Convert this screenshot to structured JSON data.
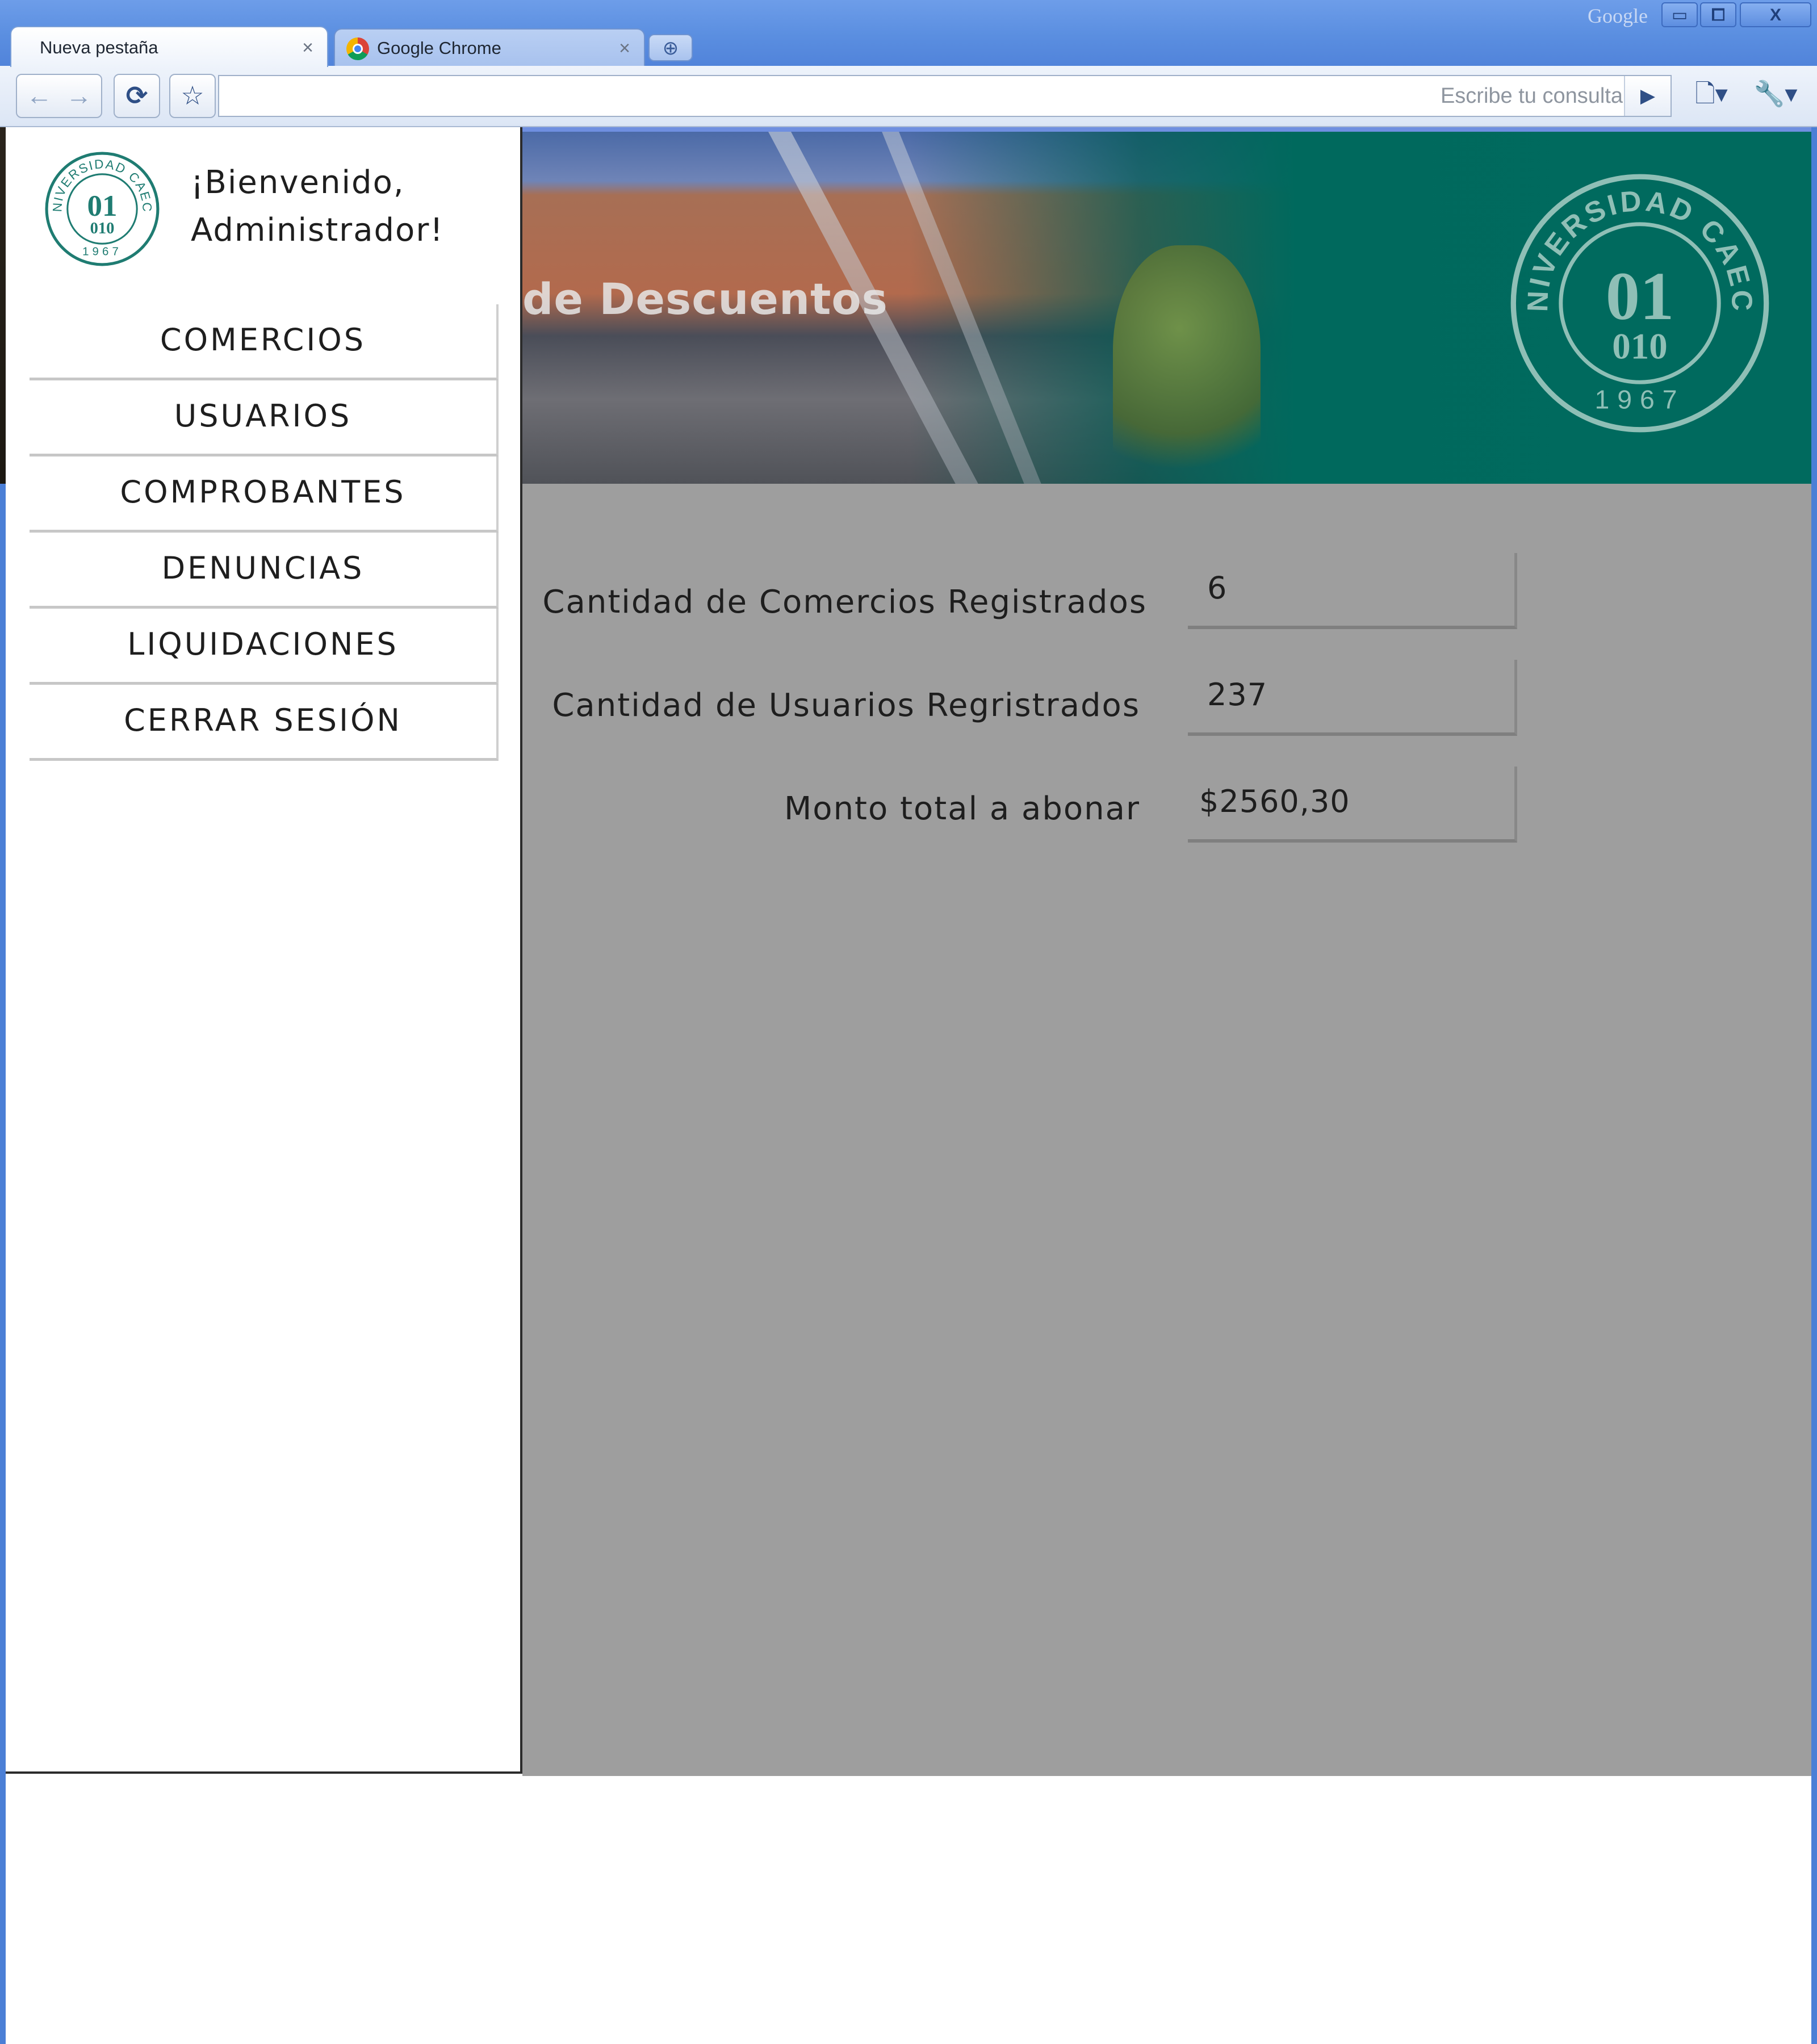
{
  "browser": {
    "google_label": "Google",
    "tabs": [
      {
        "label": "Nueva pestaña",
        "close": "×",
        "active": true
      },
      {
        "label": "Google Chrome",
        "close": "×",
        "active": false
      }
    ],
    "new_tab": "⊕",
    "window_buttons": {
      "minimize": "▭",
      "maximize": "⧠",
      "close": "X"
    },
    "toolbar": {
      "back": "←",
      "forward": "→",
      "reload": "⟳",
      "star": "☆",
      "omnibox_placeholder": "Escribe tu consulta",
      "go": "▶",
      "page_menu": "🗋▾",
      "wrench_menu": "🔧▾"
    }
  },
  "header": {
    "banner_title": "de Descuentos",
    "seal_text": "UNIVERSIDAD CAECE",
    "seal_top": "01",
    "seal_bottom": "010",
    "seal_year": "1967"
  },
  "sidebar": {
    "welcome_line1": "¡Bienvenido,",
    "welcome_line2": "Administrador!",
    "items": [
      {
        "label": "COMERCIOS"
      },
      {
        "label": "USUARIOS"
      },
      {
        "label": "COMPROBANTES"
      },
      {
        "label": "DENUNCIAS"
      },
      {
        "label": "LIQUIDACIONES"
      },
      {
        "label": "CERRAR SESIÓN"
      }
    ]
  },
  "stats": [
    {
      "label": "Cantidad de Comercios Registrados",
      "value": "6"
    },
    {
      "label": "Cantidad de Usuarios Regristrados",
      "value": "237"
    },
    {
      "label": "Monto total a abonar",
      "value": "$2560,30"
    }
  ],
  "colors": {
    "brand_teal": "#00695d",
    "content_gray": "#9e9e9e",
    "browser_blue": "#5a8ee0"
  }
}
